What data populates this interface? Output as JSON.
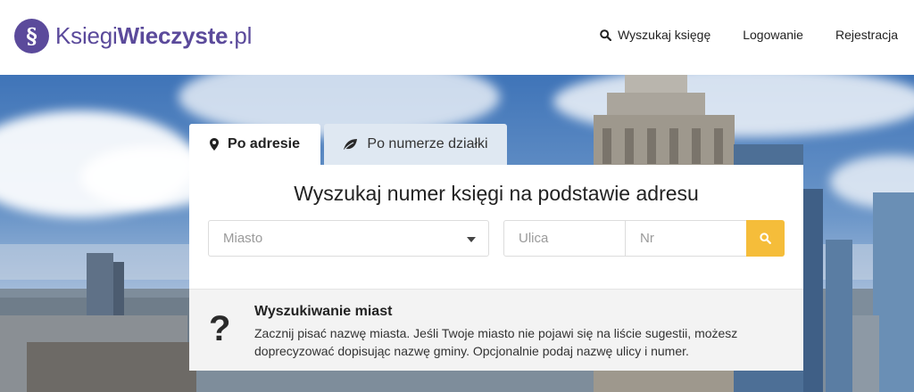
{
  "brand": {
    "badge": "§",
    "name_light": "Ksiegi",
    "name_bold": "Wieczyste",
    "name_tld": ".pl"
  },
  "nav": {
    "search_label": "Wyszukaj księgę",
    "login_label": "Logowanie",
    "register_label": "Rejestracja"
  },
  "tabs": [
    {
      "label": "Po adresie",
      "icon": "map-pin-icon",
      "active": true
    },
    {
      "label": "Po numerze działki",
      "icon": "leaf-icon",
      "active": false
    }
  ],
  "search": {
    "title": "Wyszukaj numer księgi na podstawie adresu",
    "city_placeholder": "Miasto",
    "street_placeholder": "Ulica",
    "number_placeholder": "Nr",
    "button_icon": "search-icon"
  },
  "info": {
    "icon": "question-icon",
    "title": "Wyszukiwanie miast",
    "text": "Zacznij pisać nazwę miasta. Jeśli Twoje miasto nie pojawi się na liście sugestii, możesz doprecyzować dopisując nazwę gminy. Opcjonalnie podaj nazwę ulicy i numer."
  },
  "colors": {
    "brand": "#5b4a9b",
    "accent": "#f5bd3a",
    "inactive_tab": "#dfe8f2"
  }
}
